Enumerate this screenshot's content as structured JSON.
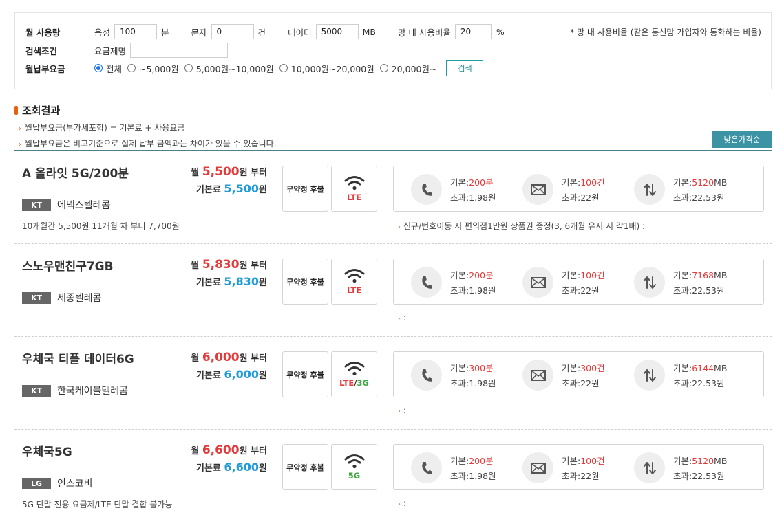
{
  "search": {
    "usage_label": "월 사용량",
    "voice_label": "음성",
    "voice_value": "100",
    "voice_unit": "분",
    "sms_label": "문자",
    "sms_value": "0",
    "sms_unit": "건",
    "data_label": "데이터",
    "data_value": "5000",
    "data_unit": "MB",
    "onnet_label": "망 내 사용비율",
    "onnet_value": "20",
    "onnet_unit": "%",
    "note": "* 망 내 사용비율 (같은 통신망 가입자와 통화하는 비율)",
    "criteria_label": "검색조건",
    "plan_name_label": "요금제명",
    "plan_name_value": "",
    "fee_label": "월납부요금",
    "fee_options": [
      "전체",
      "~5,000원",
      "5,000원~10,000원",
      "10,000원~20,000원",
      "20,000원~"
    ],
    "fee_selected": 0,
    "search_button": "검색"
  },
  "results": {
    "title": "조회결과",
    "info1": "월납부요금(부가세포함) = 기본료 + 사용요금",
    "info2": "월납부요금은 비교기준으로 실제 납부 금액과는 차이가 있을 수 있습니다.",
    "sort_button": "낮은가격순",
    "plans": [
      {
        "name": "A 올라잇 5G/200분",
        "carrier": "KT",
        "provider": "에넥스텔레콤",
        "sub": "10개월간 5,500원 11개월 차 부터 7,700원",
        "price_prefix": "월",
        "monthly_price": "5,500",
        "price_suffix": "원 부터",
        "base_label": "기본료",
        "base_price": "5,500",
        "base_suffix": "원",
        "contract": "무약정 후불",
        "net_main": "LTE",
        "net_sep": "",
        "net_extra": "",
        "voice_base": "기본:",
        "voice_value": "200분",
        "voice_over": "초과:1.98원",
        "sms_base": "기본:",
        "sms_value": "100건",
        "sms_over": "초과:22원",
        "data_base": "기본:",
        "data_value": "5120",
        "data_unit": "MB",
        "data_over": "초과:22.53원",
        "promo": "신규/번호이동 시 편의점1만원 상품권 증정(3, 6개월 유지 시 각1매) :"
      },
      {
        "name": "스노우맨친구7GB",
        "carrier": "KT",
        "provider": "세종텔레콤",
        "sub": "",
        "price_prefix": "월",
        "monthly_price": "5,830",
        "price_suffix": "원 부터",
        "base_label": "기본료",
        "base_price": "5,830",
        "base_suffix": "원",
        "contract": "무약정 후불",
        "net_main": "LTE",
        "net_sep": "",
        "net_extra": "",
        "voice_base": "기본:",
        "voice_value": "200분",
        "voice_over": "초과:1.98원",
        "sms_base": "기본:",
        "sms_value": "100건",
        "sms_over": "초과:22원",
        "data_base": "기본:",
        "data_value": "7168",
        "data_unit": "MB",
        "data_over": "초과:22.53원",
        "promo": ":"
      },
      {
        "name": "우체국 티플 데이터6G",
        "carrier": "KT",
        "provider": "한국케이블텔레콤",
        "sub": "",
        "price_prefix": "월",
        "monthly_price": "6,000",
        "price_suffix": "원 부터",
        "base_label": "기본료",
        "base_price": "6,000",
        "base_suffix": "원",
        "contract": "무약정 후불",
        "net_main": "LTE",
        "net_sep": "/",
        "net_extra": "3G",
        "voice_base": "기본:",
        "voice_value": "300분",
        "voice_over": "초과:1.98원",
        "sms_base": "기본:",
        "sms_value": "300건",
        "sms_over": "초과:22원",
        "data_base": "기본:",
        "data_value": "6144",
        "data_unit": "MB",
        "data_over": "초과:22.53원",
        "promo": ":"
      },
      {
        "name": "우체국5G",
        "carrier": "LG",
        "provider": "인스코비",
        "sub": "5G 단말 전용 요금제/LTE 단말 결합 불가능",
        "price_prefix": "월",
        "monthly_price": "6,600",
        "price_suffix": "원 부터",
        "base_label": "기본료",
        "base_price": "6,600",
        "base_suffix": "원",
        "contract": "무약정 후불",
        "net_main": "",
        "net_sep": "",
        "net_extra": "5G",
        "voice_base": "기본:",
        "voice_value": "200분",
        "voice_over": "초과:1.98원",
        "sms_base": "기본:",
        "sms_value": "100건",
        "sms_over": "초과:22원",
        "data_base": "기본:",
        "data_value": "5120",
        "data_unit": "MB",
        "data_over": "초과:22.53원",
        "promo": ":"
      }
    ]
  },
  "icons": {
    "voice": "phone-icon",
    "sms": "envelope-icon",
    "data": "data-arrows-icon",
    "network": "wifi-icon"
  },
  "colors": {
    "price_red": "#e33b3b",
    "price_blue": "#1f9bd7",
    "accent_teal": "#3c93a4",
    "bullet_orange": "#e8600c",
    "network_green": "#3ea63e"
  }
}
